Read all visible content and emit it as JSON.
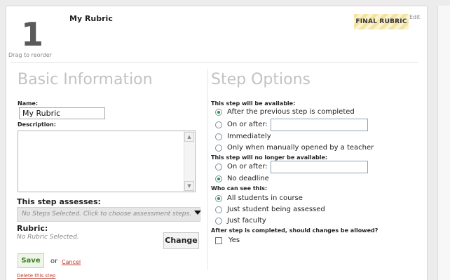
{
  "header": {
    "step_number": "1",
    "drag_hint": "Drag to reorder",
    "title": "My Rubric",
    "badge": "FINAL RUBRIC",
    "edit": "Edit"
  },
  "basic": {
    "heading": "Basic Information",
    "name_label": "Name:",
    "name_value": "My Rubric",
    "description_label": "Description:",
    "assess_label": "This step assesses:",
    "assess_placeholder": "No Steps Selected. Click to choose assessment steps.",
    "rubric_label": "Rubric:",
    "rubric_value": "No Rubric Selected.",
    "change_button": "Change",
    "save_button": "Save",
    "or_text": "or",
    "cancel_link": "Cancel",
    "delete_link": "Delete this step"
  },
  "options": {
    "heading": "Step Options",
    "available_label": "This step will be available:",
    "available_options": [
      {
        "label": "After the previous step is completed",
        "selected": true
      },
      {
        "label": "On or after:",
        "selected": false
      },
      {
        "label": "Immediately",
        "selected": false
      },
      {
        "label": "Only when manually opened by a teacher",
        "selected": false
      }
    ],
    "unavailable_label": "This step will no longer be available:",
    "unavailable_options": [
      {
        "label": "On or after:",
        "selected": false
      },
      {
        "label": "No deadline",
        "selected": true
      }
    ],
    "visibility_label": "Who can see this:",
    "visibility_options": [
      {
        "label": "All students in course",
        "selected": true
      },
      {
        "label": "Just student being assessed",
        "selected": false
      },
      {
        "label": "Just faculty",
        "selected": false
      }
    ],
    "changes_label": "After step is completed, should changes be allowed?",
    "changes_option": {
      "label": "Yes",
      "checked": false
    }
  },
  "colors": {
    "accent_green": "#1f9b3e",
    "link_red": "#c0392b",
    "heading_gray": "#c2c2c2"
  }
}
